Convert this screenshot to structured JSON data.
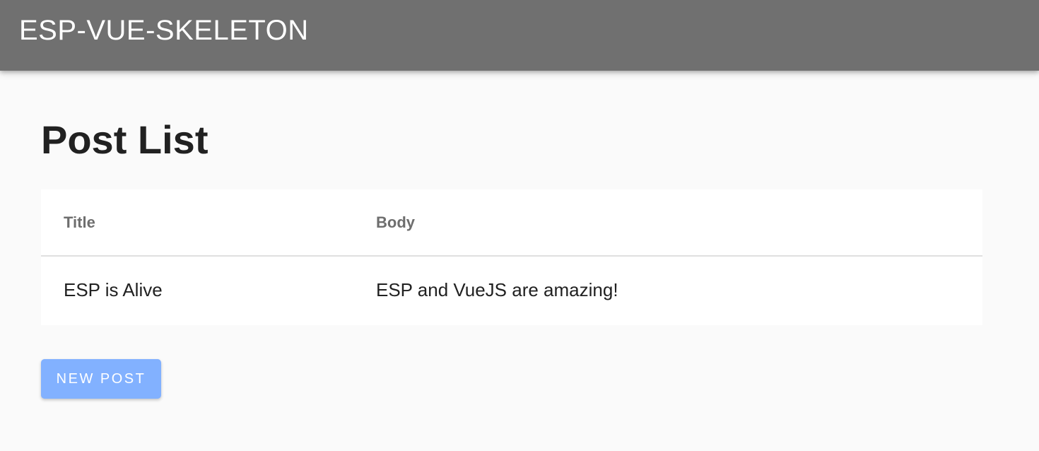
{
  "app_bar": {
    "title": "ESP-VUE-SKELETON"
  },
  "main": {
    "page_title": "Post List",
    "table": {
      "headers": {
        "title": "Title",
        "body": "Body"
      },
      "rows": [
        {
          "title": "ESP is Alive",
          "body": "ESP and VueJS are amazing!"
        }
      ]
    },
    "new_post_label": "New Post"
  },
  "colors": {
    "app_bar": "#707070",
    "background": "#fafafa",
    "button": "#82b1ff",
    "text": "#212121",
    "header_text": "#6e6e6e"
  }
}
